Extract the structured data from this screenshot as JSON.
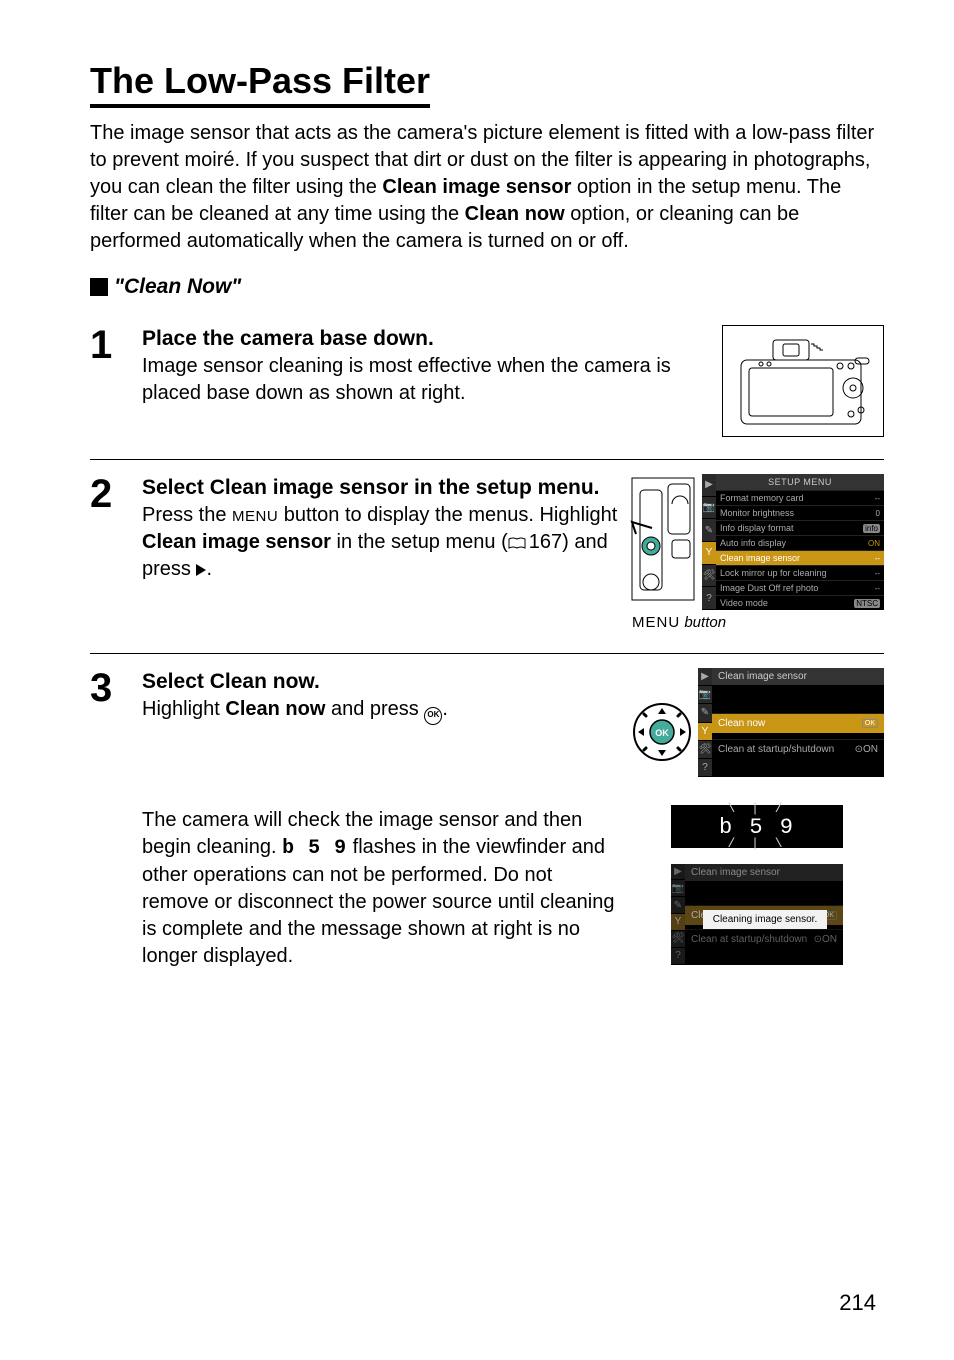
{
  "page_number": "214",
  "title": "The Low-Pass Filter",
  "intro_parts": {
    "p1": "The image sensor that acts as the camera's picture element is fitted with a low-pass filter to prevent moiré.  If you suspect that dirt or dust on the filter is appearing in photographs, you can clean the filter using the ",
    "b1": "Clean image sensor",
    "p2": " option in the setup menu.  The filter can be cleaned at any time using the ",
    "b2": "Clean now",
    "p3": " option, or cleaning can be performed automatically when the camera is turned on or off."
  },
  "subhead": "\"Clean Now\"",
  "steps": {
    "s1": {
      "num": "1",
      "lead": "Place the camera base down.",
      "body": "Image sensor cleaning is most effective when the camera is placed base down as shown at right."
    },
    "s2": {
      "num": "2",
      "lead_a": "Select ",
      "lead_b": "Clean image sensor",
      "lead_c": " in the setup menu.",
      "body_a": "Press the ",
      "menu_word": "MENU",
      "body_b": " button to display the menus.  Highlight ",
      "bold_opt": "Clean image sensor",
      "body_c": " in the setup menu (",
      "ref": "167",
      "body_d": ") and press ",
      "body_e": "."
    },
    "s3": {
      "num": "3",
      "lead_a": "Select ",
      "lead_b": "Clean now",
      "lead_c": ".",
      "body1_a": "Highlight ",
      "body1_b": "Clean now",
      "body1_c": " and press ",
      "body1_d": ".",
      "body2_a": "The camera will check the image sensor and then begin cleaning.  ",
      "busy_glyph": "b 5 9",
      "body2_b": " flashes in the viewfinder and other operations can not be performed.  Do not remove or disconnect the power source until cleaning is complete and the message shown at right is no longer displayed."
    }
  },
  "menu_caption": {
    "label": "MENU",
    "suffix": " button"
  },
  "setup_menu": {
    "title": "SETUP MENU",
    "rows": [
      {
        "label": "Format memory card",
        "val": "--"
      },
      {
        "label": "Monitor brightness",
        "val": "0"
      },
      {
        "label": "Info display format",
        "val": "info"
      },
      {
        "label": "Auto info display",
        "val": "ON"
      },
      {
        "label": "Clean image sensor",
        "val": "--",
        "highlight": true
      },
      {
        "label": "Lock mirror up for cleaning",
        "val": "--"
      },
      {
        "label": "Image Dust Off ref photo",
        "val": "--"
      },
      {
        "label": "Video mode",
        "val": "NTSC"
      }
    ],
    "tabs": [
      "▶",
      "📷",
      "✎",
      "Y",
      "🛠",
      "?"
    ]
  },
  "clean_menu": {
    "title": "Clean image sensor",
    "rows": [
      {
        "label": "Clean now",
        "ok": "OK",
        "sel": true
      },
      {
        "label": "Clean at startup/shutdown",
        "ok": "⊙ON"
      }
    ]
  },
  "busy": {
    "top_ticks": "\\  |  /",
    "segs": "b 5 9",
    "bot_ticks": "/  |  \\"
  },
  "msg_menu": {
    "title": "Clean image sensor",
    "row_behind": "Clea",
    "popup": "Cleaning image sensor.",
    "row_ok": "OK",
    "row2": "Clean at startup/shutdown",
    "row2_ok": "⊙ON"
  }
}
